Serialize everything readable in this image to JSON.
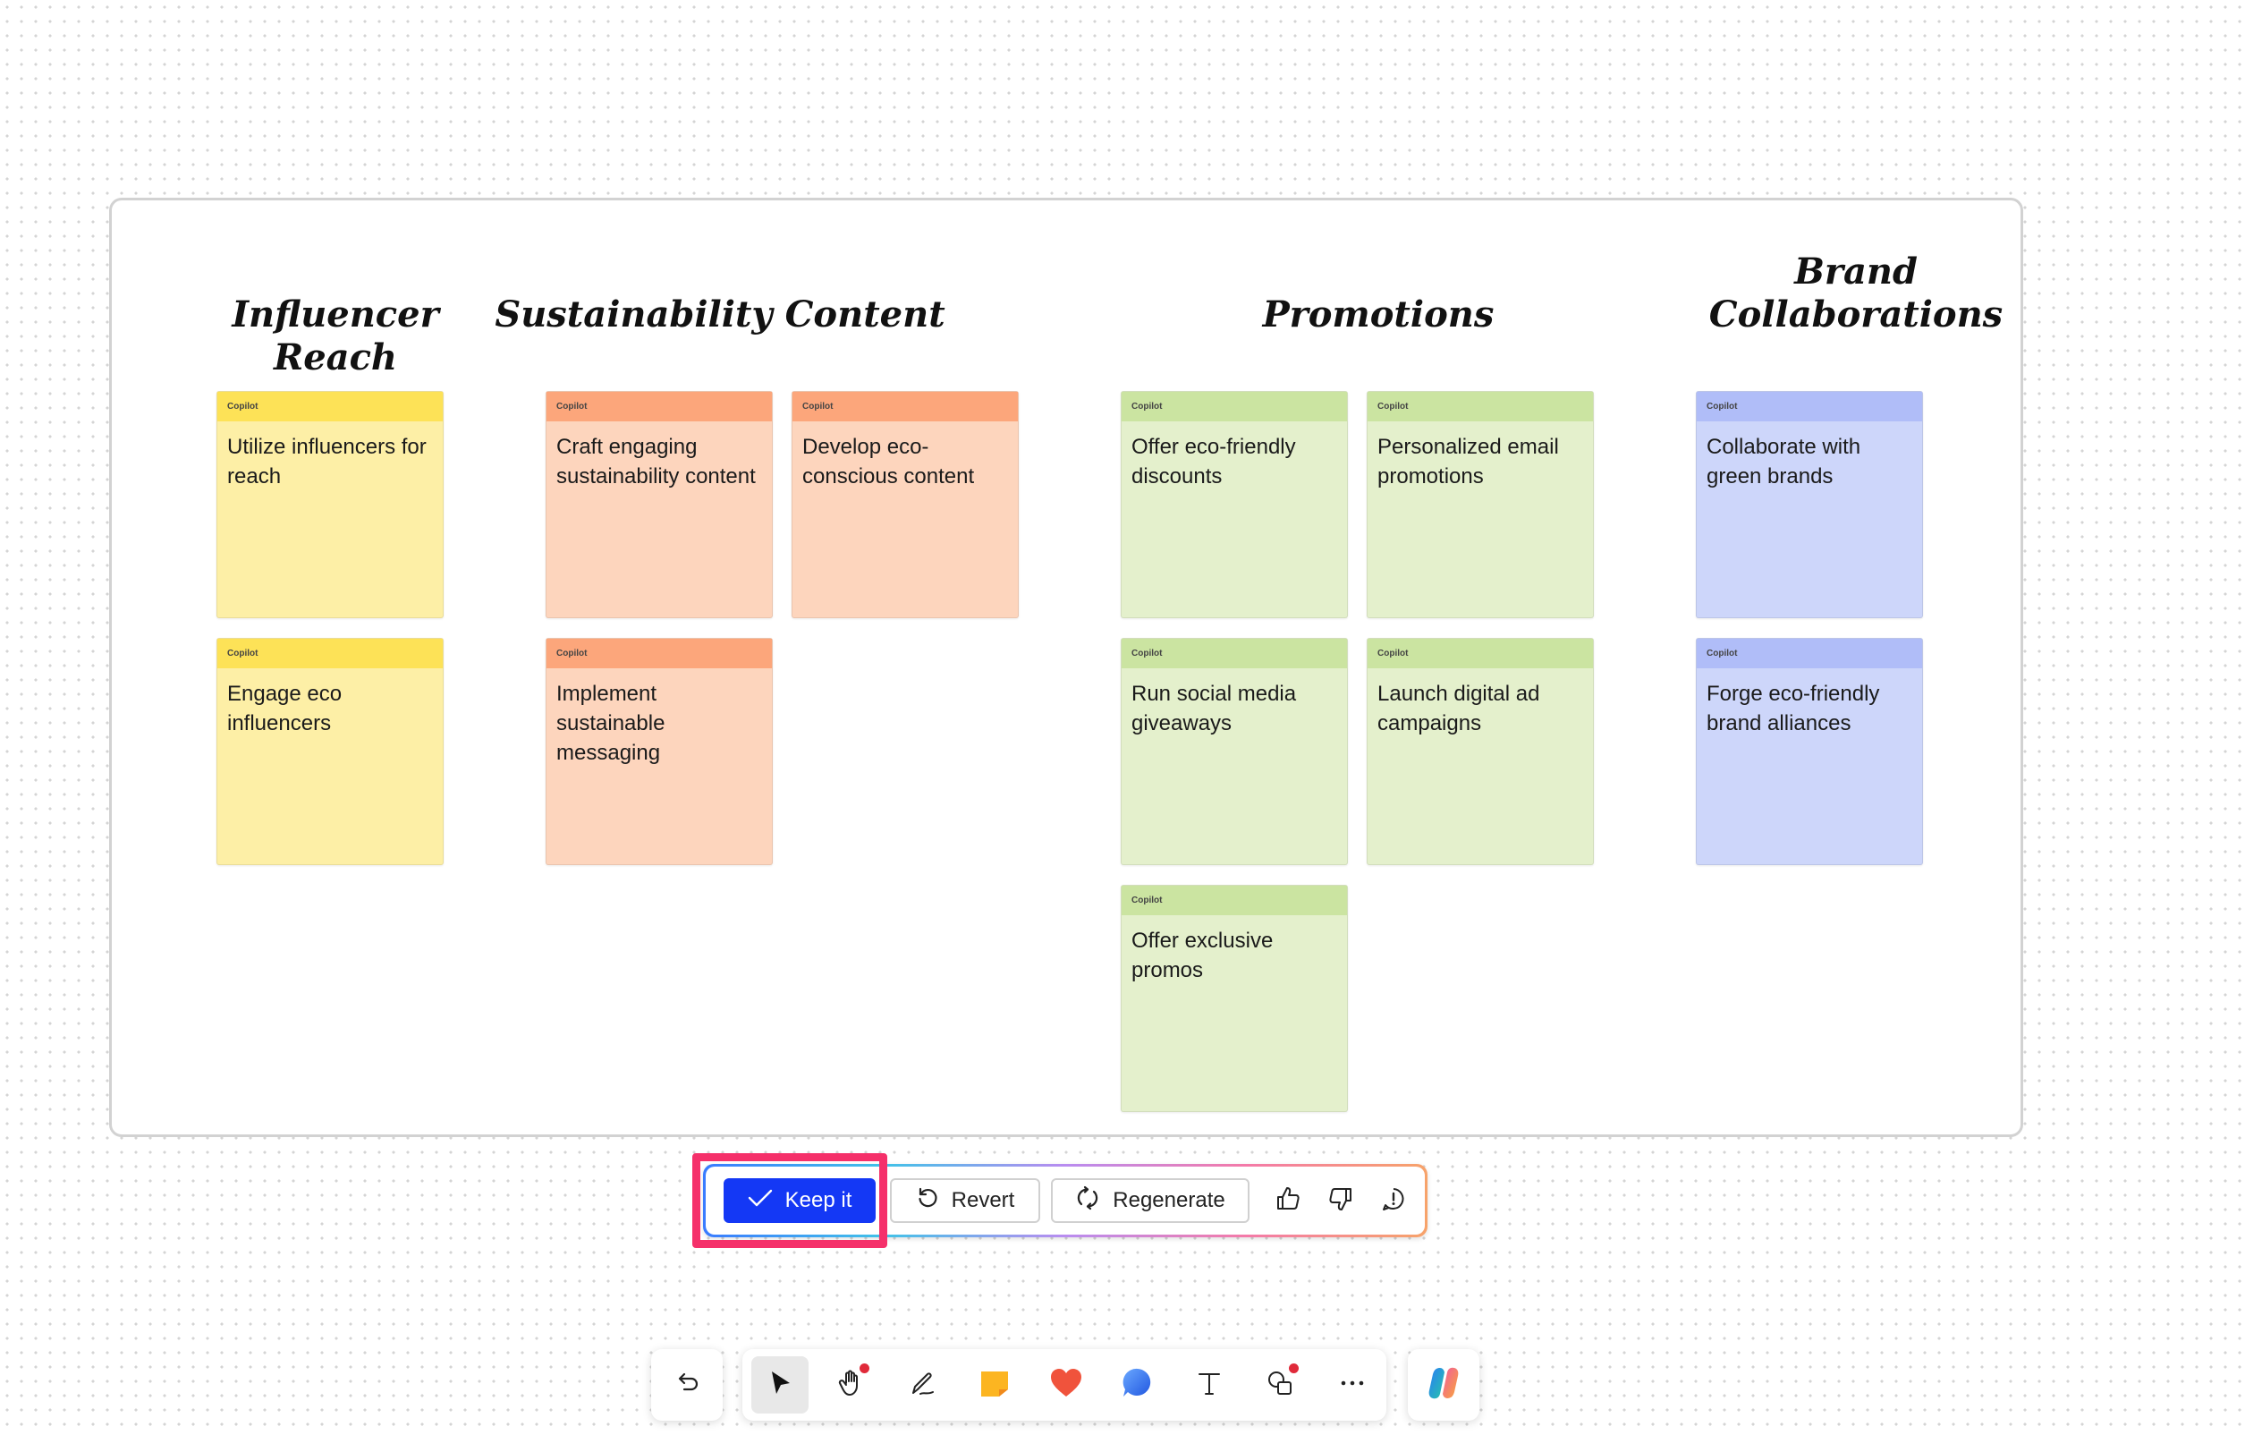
{
  "groups": [
    {
      "title_line1": "Influencer Reach",
      "title_line2": "",
      "notes": [
        {
          "header": "Copilot",
          "text": "Utilize influencers for reach",
          "color": "yellow"
        },
        {
          "header": "Copilot",
          "text": "Engage eco influencers",
          "color": "yellow"
        }
      ]
    },
    {
      "title_line1": "Sustainability Content",
      "title_line2": "",
      "notes": [
        {
          "header": "Copilot",
          "text": "Craft engaging sustainability content",
          "color": "orange"
        },
        {
          "header": "Copilot",
          "text": "Develop eco-conscious content",
          "color": "orange"
        },
        {
          "header": "Copilot",
          "text": "Implement sustainable messaging",
          "color": "orange"
        }
      ]
    },
    {
      "title_line1": "Promotions",
      "title_line2": "",
      "notes": [
        {
          "header": "Copilot",
          "text": "Offer eco-friendly discounts",
          "color": "green"
        },
        {
          "header": "Copilot",
          "text": "Personalized email promotions",
          "color": "green"
        },
        {
          "header": "Copilot",
          "text": "Run social media giveaways",
          "color": "green"
        },
        {
          "header": "Copilot",
          "text": "Launch digital ad campaigns",
          "color": "green"
        },
        {
          "header": "Copilot",
          "text": "Offer exclusive promos",
          "color": "green"
        }
      ]
    },
    {
      "title_line1": "Brand",
      "title_line2": "Collaborations",
      "notes": [
        {
          "header": "Copilot",
          "text": "Collaborate with green brands",
          "color": "blue"
        },
        {
          "header": "Copilot",
          "text": "Forge eco-friendly brand alliances",
          "color": "blue"
        }
      ]
    }
  ],
  "action_bar": {
    "keep_label": "Keep it",
    "revert_label": "Revert",
    "regenerate_label": "Regenerate"
  },
  "colors": {
    "accent": "#1438f5",
    "highlight": "#f5306a",
    "yellow_note": "#fdefa6",
    "orange_note": "#fdd5bd",
    "green_note": "#e4f0cc",
    "blue_note": "#cdd6fa"
  },
  "toolbar": {
    "tools": [
      "undo-icon",
      "select-pointer-icon",
      "hand-pan-icon",
      "pen-icon",
      "sticky-note-icon",
      "reaction-heart-icon",
      "comment-bubble-icon",
      "text-icon",
      "shapes-icon",
      "more-options-icon",
      "copilot-icon"
    ]
  }
}
